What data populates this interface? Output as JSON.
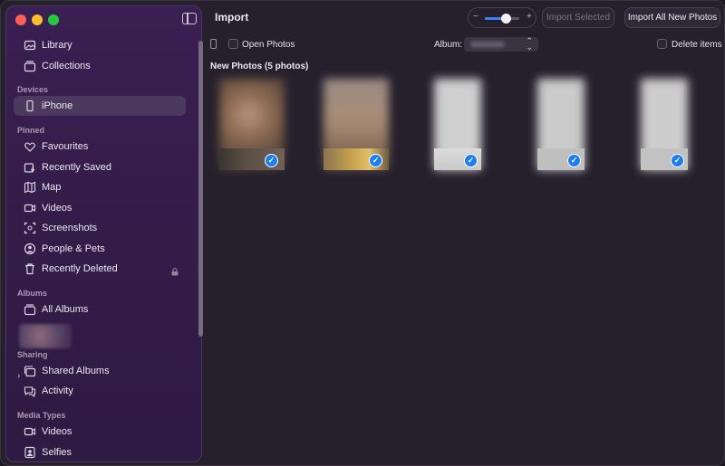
{
  "window": {
    "title": "Import"
  },
  "sidebar": {
    "top_items": [
      {
        "label": "Library",
        "icon": "photo-library-icon"
      },
      {
        "label": "Collections",
        "icon": "collections-icon"
      }
    ],
    "sections": {
      "devices": "Devices",
      "pinned": "Pinned",
      "albums": "Albums",
      "sharing": "Sharing",
      "media_types": "Media Types"
    },
    "devices": [
      {
        "label": "iPhone",
        "icon": "iphone-icon",
        "selected": true
      }
    ],
    "pinned": [
      {
        "label": "Favourites",
        "icon": "heart-icon"
      },
      {
        "label": "Recently Saved",
        "icon": "recently-saved-icon"
      },
      {
        "label": "Map",
        "icon": "map-icon"
      },
      {
        "label": "Videos",
        "icon": "video-icon"
      },
      {
        "label": "Screenshots",
        "icon": "screenshot-icon"
      },
      {
        "label": "People & Pets",
        "icon": "person-icon"
      },
      {
        "label": "Recently Deleted",
        "icon": "trash-icon",
        "locked": true
      }
    ],
    "albums": [
      {
        "label": "All Albums",
        "icon": "albums-icon"
      }
    ],
    "sharing": [
      {
        "label": "Shared Albums",
        "icon": "shared-albums-icon"
      },
      {
        "label": "Activity",
        "icon": "activity-icon"
      }
    ],
    "media_types": [
      {
        "label": "Videos",
        "icon": "video-icon"
      },
      {
        "label": "Selfies",
        "icon": "selfie-icon"
      }
    ]
  },
  "toolbar": {
    "zoom_minus": "−",
    "zoom_plus": "+",
    "zoom_level": 0.6,
    "import_selected_label": "Import Selected",
    "import_all_label": "Import All New Photos"
  },
  "options": {
    "open_photos_label": "Open Photos",
    "album_label": "Album:",
    "delete_items_label": "Delete items"
  },
  "new_photos": {
    "heading": "New Photos (5 photos)",
    "count": 5,
    "all_selected": true
  },
  "colors": {
    "accent": "#1f7df0",
    "sidebar_bg": "#3a1f52",
    "window_bg": "#26202d"
  }
}
